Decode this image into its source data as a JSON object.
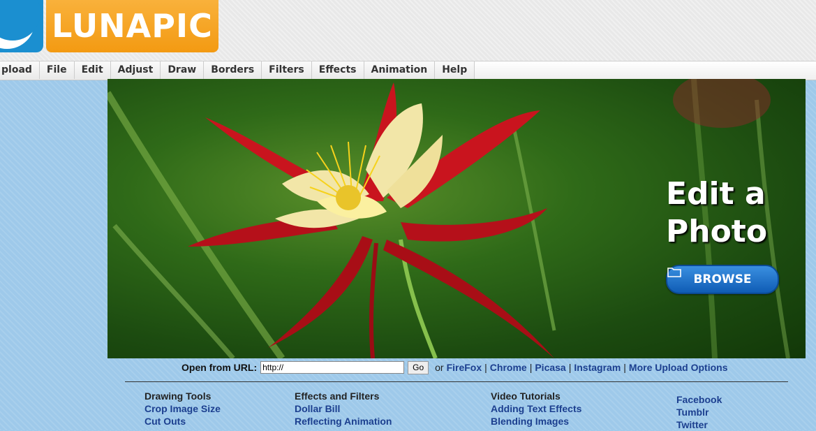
{
  "logo": {
    "text": "LUNAPIC"
  },
  "menu": [
    "pload",
    "File",
    "Edit",
    "Adjust",
    "Draw",
    "Borders",
    "Filters",
    "Effects",
    "Animation",
    "Help"
  ],
  "hero": {
    "title_line1": "Edit a",
    "title_line2": "Photo",
    "browse_label": "BROWSE"
  },
  "url_row": {
    "label": "Open from URL:",
    "input_value": "http://",
    "go_label": "Go",
    "or_text": "or",
    "links": [
      "FireFox",
      "Chrome",
      "Picasa",
      "Instagram",
      "More Upload Options"
    ],
    "separator": "|"
  },
  "footer": {
    "col1": {
      "header": "Drawing Tools",
      "links": [
        "Crop Image Size",
        "Cut Outs"
      ]
    },
    "col2": {
      "header": "Effects and Filters",
      "links": [
        "Dollar Bill",
        "Reflecting Animation"
      ]
    },
    "col3": {
      "header": "Video Tutorials",
      "links": [
        "Adding Text Effects",
        "Blending Images"
      ]
    },
    "col4": {
      "links": [
        "Facebook",
        "Tumblr",
        "Twitter"
      ]
    }
  },
  "colors": {
    "logo_orange": "#f39a12",
    "logo_blue": "#1b8fd0",
    "link_blue": "#1c3f8f",
    "browse_blue": "#0f5cb5"
  },
  "icons": {
    "browse": "folder-icon"
  }
}
